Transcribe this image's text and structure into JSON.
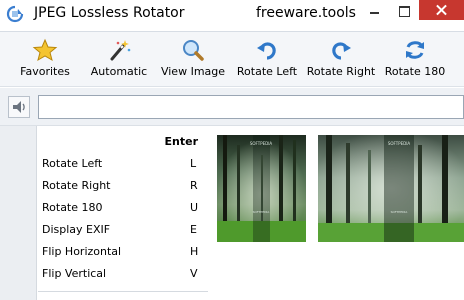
{
  "window": {
    "title": "JPEG Lossless Rotator",
    "brand": "freeware.tools",
    "icons": {
      "app": "app-icon",
      "minimize": "minimize-icon",
      "maximize": "maximize-icon",
      "close": "close-icon"
    },
    "close_color": "#c7372f"
  },
  "toolbar": {
    "buttons": [
      {
        "label": "Favorites",
        "icon": "star-icon"
      },
      {
        "label": "Automatic",
        "icon": "magic-wand-icon"
      },
      {
        "label": "View Image",
        "icon": "magnifier-icon"
      },
      {
        "label": "Rotate Left",
        "icon": "rotate-left-icon"
      },
      {
        "label": "Rotate Right",
        "icon": "rotate-right-icon"
      },
      {
        "label": "Rotate 180",
        "icon": "rotate-180-icon"
      }
    ]
  },
  "search": {
    "value": "",
    "placeholder": "",
    "icon": "speaker-icon"
  },
  "commands": {
    "header_key": "Enter",
    "items": [
      {
        "name": "Rotate Left",
        "key": "L"
      },
      {
        "name": "Rotate Right",
        "key": "R"
      },
      {
        "name": "Rotate 180",
        "key": "U"
      },
      {
        "name": "Display EXIF",
        "key": "E"
      },
      {
        "name": "Flip Horizontal",
        "key": "H"
      },
      {
        "name": "Flip Vertical",
        "key": "V"
      }
    ]
  },
  "images": [
    {
      "caption": "SOFTPEDIA",
      "subcaption": "SOFTPEDIA",
      "orientation": "portrait"
    },
    {
      "caption": "SOFTPEDIA",
      "subcaption": "SOFTPEDIA",
      "orientation": "landscape"
    }
  ]
}
